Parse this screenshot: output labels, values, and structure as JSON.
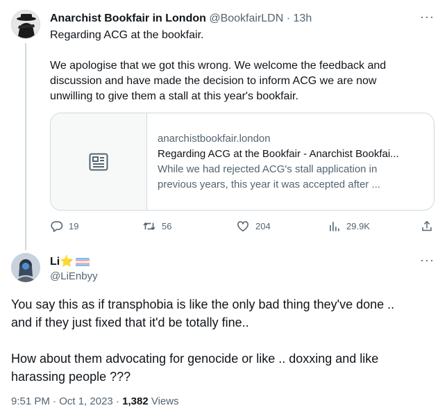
{
  "tweet1": {
    "author_name": "Anarchist Bookfair in London",
    "handle": "@BookfairLDN",
    "separator": "·",
    "time": "13h",
    "more": "···",
    "lines_p1": [
      "Regarding ACG at the bookfair."
    ],
    "lines_p2": [
      "We apologise that we got this wrong. We welcome the feedback and",
      "discussion and have made the decision to inform ACG we are now",
      "unwilling  to give them a stall at this year's bookfair."
    ],
    "card": {
      "domain": "anarchistbookfair.london",
      "title": "Regarding ACG at the Bookfair - Anarchist Bookfai...",
      "desc_lines": [
        "While we had rejected ACG's stall application in",
        "previous years, this year it was accepted after ..."
      ],
      "icon": "article-icon"
    },
    "actions": {
      "replies": "19",
      "retweets": "56",
      "likes": "204",
      "views": "29.9K"
    }
  },
  "tweet2": {
    "author_name": "Li⭐",
    "flag_colors": [
      "#5BCEFA",
      "#F5A9B8",
      "#FFFFFF",
      "#F5A9B8",
      "#5BCEFA"
    ],
    "handle": "@LiEnbyy",
    "more": "···",
    "lines_p1": [
      "You say this as if transphobia is like the only bad thing they've done ..",
      "and if they just fixed that it'd be totally fine.."
    ],
    "lines_p2": [
      "How about them advocating for genocide or like .. doxxing and like",
      "harassing people ???"
    ],
    "meta": {
      "time": "9:51 PM",
      "separator": "·",
      "date": "Oct 1, 2023",
      "separator2": "·",
      "views_count": "1,382",
      "views_label": "Views"
    }
  },
  "colors": {
    "text": "#0f1419",
    "secondary": "#536471",
    "border": "#cfd9de"
  }
}
